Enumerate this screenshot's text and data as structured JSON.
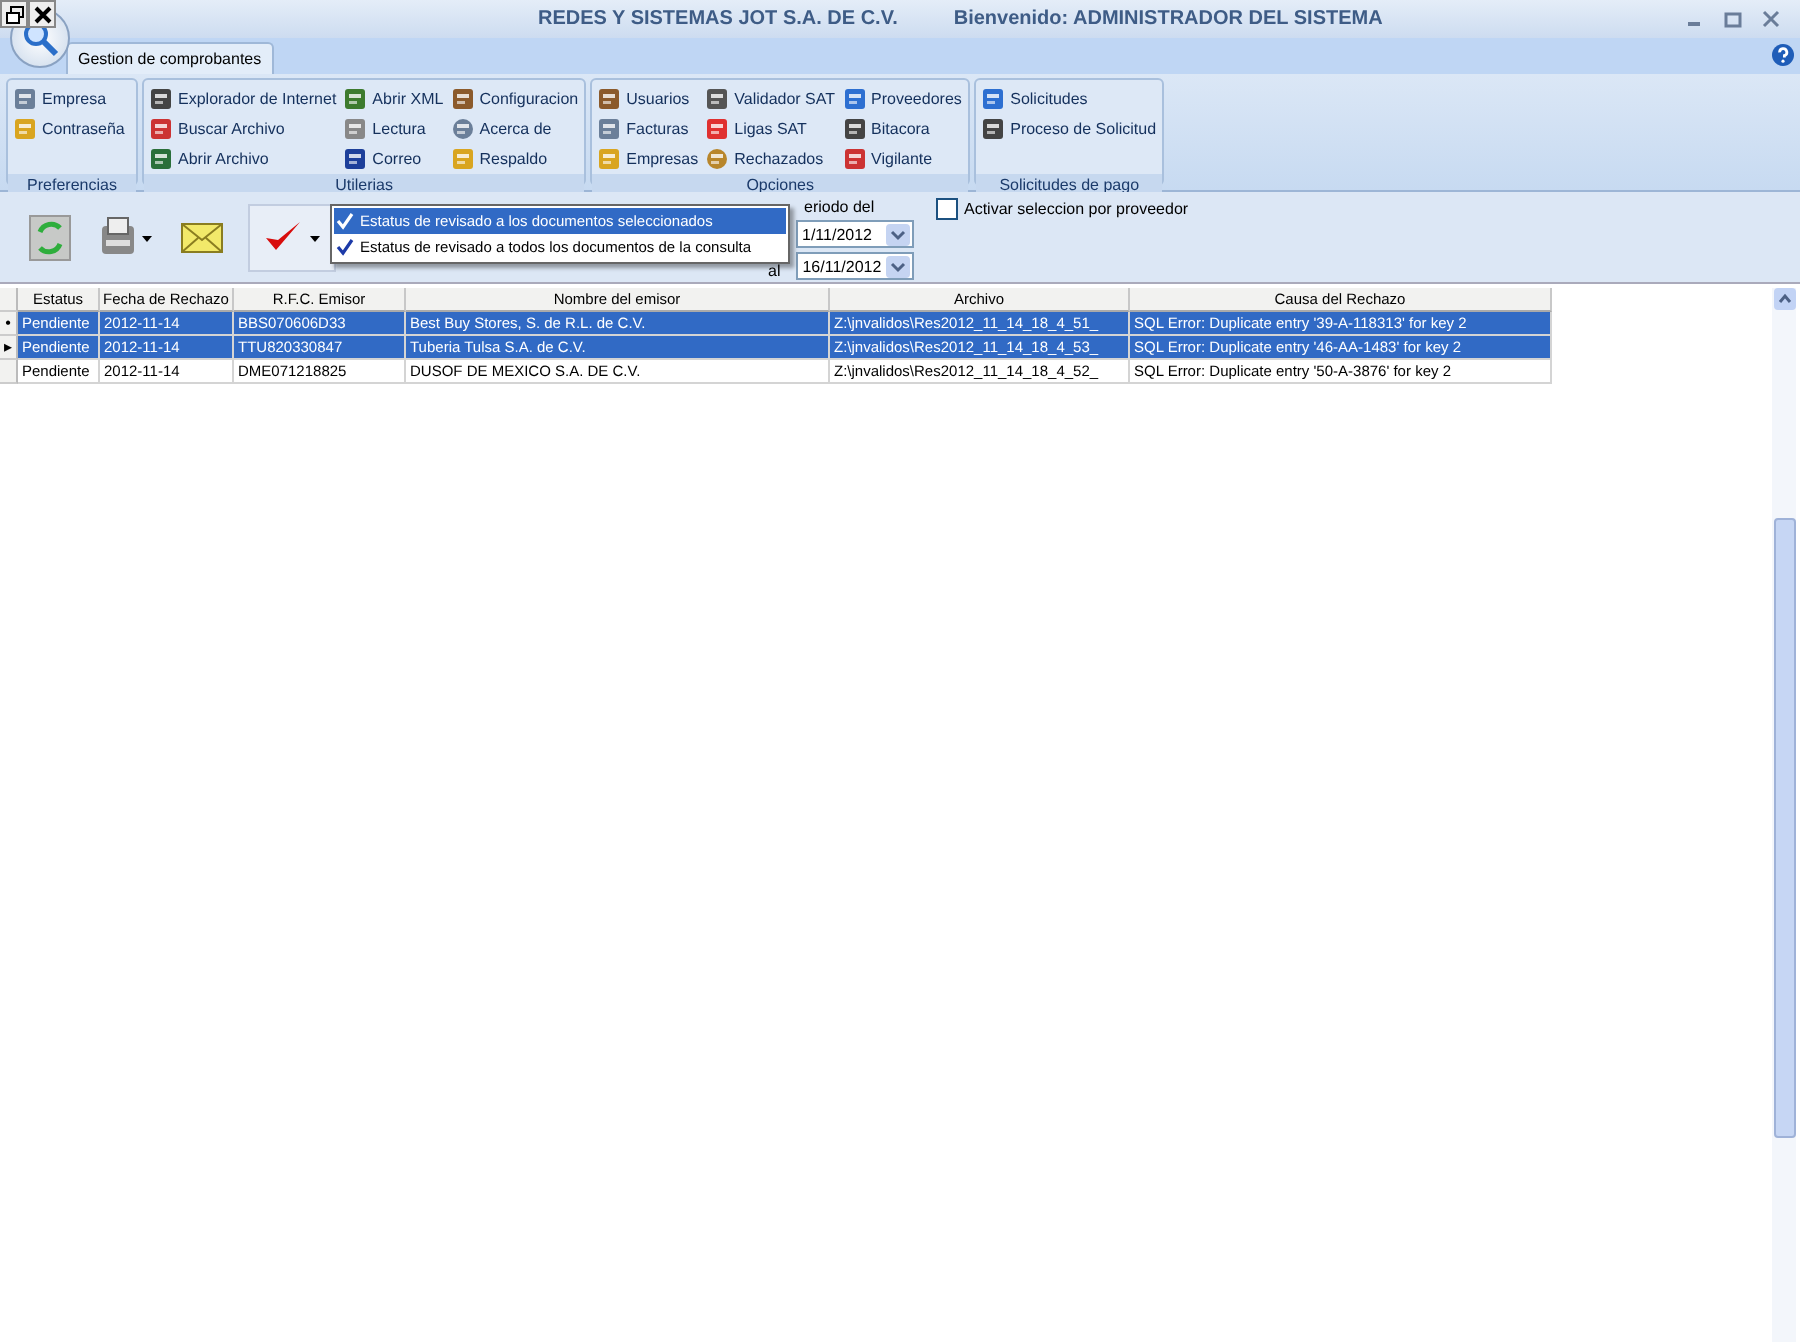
{
  "window": {
    "title": "REDES Y SISTEMAS JOT S.A. DE C.V.",
    "welcome": "Bienvenido: ADMINISTRADOR DEL SISTEMA"
  },
  "tabs": [
    {
      "label": "Gestion de comprobantes",
      "selected": true
    }
  ],
  "ribbon_groups": [
    {
      "label": "Preferencias",
      "items": [
        "Empresa",
        "Contraseña"
      ]
    },
    {
      "label": "Utilerias",
      "items": [
        "Explorador de Internet",
        "Buscar Archivo",
        "Abrir Archivo",
        "Abrir XML",
        "Lectura",
        "Correo",
        "Configuracion",
        "Acerca de",
        "Respaldo"
      ]
    },
    {
      "label": "Opciones",
      "items": [
        "Usuarios",
        "Facturas",
        "Empresas",
        "Validador SAT",
        "Ligas SAT",
        "Rechazados",
        "Proveedores",
        "Bitacora",
        "Vigilante"
      ]
    },
    {
      "label": "Solicitudes de pago",
      "items": [
        "Solicitudes",
        "Proceso de Solicitud"
      ]
    }
  ],
  "period": {
    "label": "eriodo del",
    "from": "1/11/2012",
    "to_label": "al",
    "to": "16/11/2012"
  },
  "provider_filter": {
    "label": "Activar seleccion  por proveedor",
    "checked": false
  },
  "dropdown_menu": [
    {
      "label": "Estatus de revisado a los documentos seleccionados",
      "checked": true,
      "selected": true
    },
    {
      "label": "Estatus de revisado a todos los documentos de la consulta",
      "checked": true,
      "selected": false
    }
  ],
  "table": {
    "columns": [
      "Estatus",
      "Fecha de Rechazo",
      "R.F.C. Emisor",
      "Nombre del emisor",
      "Archivo",
      "Causa del Rechazo"
    ],
    "rows": [
      {
        "marker": "•",
        "selected": true,
        "cells": [
          "Pendiente",
          "2012-11-14",
          "BBS070606D33",
          "Best Buy Stores, S. de R.L. de C.V.",
          "Z:\\jnvalidos\\Res2012_11_14_18_4_51_",
          "SQL Error: Duplicate entry '39-A-118313' for key 2"
        ]
      },
      {
        "marker": "▸",
        "selected": true,
        "cells": [
          "Pendiente",
          "2012-11-14",
          "TTU820330847",
          "Tuberia Tulsa S.A. de C.V.",
          "Z:\\jnvalidos\\Res2012_11_14_18_4_53_",
          "SQL Error: Duplicate entry '46-AA-1483' for key 2"
        ]
      },
      {
        "selected": false,
        "cells": [
          "Pendiente",
          "2012-11-14",
          "DME071218825",
          "DUSOF DE MEXICO S.A. DE C.V.",
          "Z:\\jnvalidos\\Res2012_11_14_18_4_52_",
          "SQL Error: Duplicate entry '50-A-3876' for key 2"
        ]
      }
    ]
  }
}
